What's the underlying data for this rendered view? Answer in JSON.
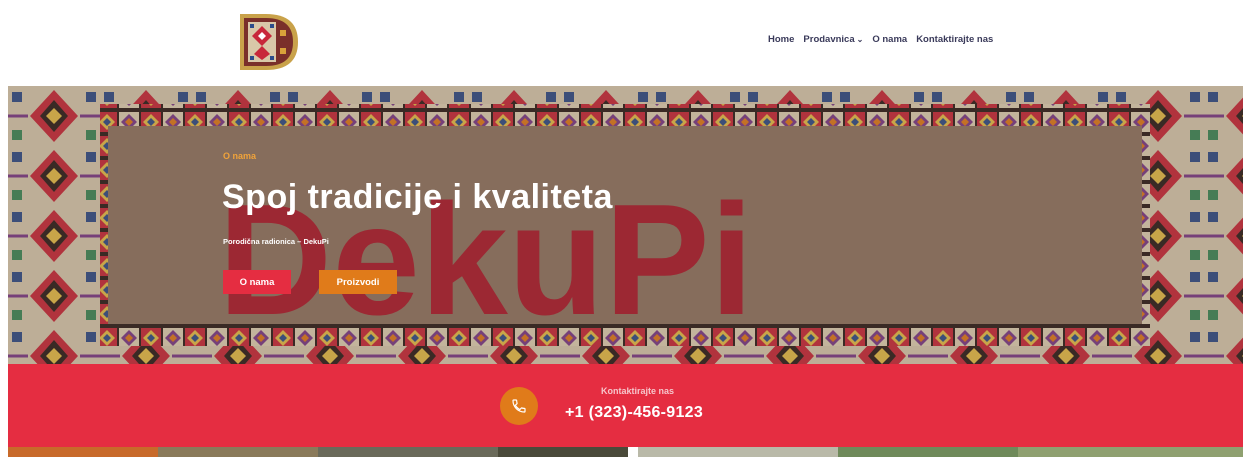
{
  "brand": {
    "logo_icon": "dekupi-d-logo-icon"
  },
  "nav": {
    "items": [
      {
        "label": "Home"
      },
      {
        "label": "Prodavnica",
        "has_dropdown": true,
        "chevron": "⌄"
      },
      {
        "label": "O nama"
      },
      {
        "label": "Kontaktirajte nas"
      }
    ]
  },
  "hero": {
    "tag": "O nama",
    "title": "Spoj tradicije i kvaliteta",
    "subtitle": "Porodična radionica – DekuPi",
    "watermark": "DekuPi",
    "buttons": {
      "primary": "O nama",
      "secondary": "Proizvodi"
    }
  },
  "contact": {
    "label": "Kontaktirajte nas",
    "phone": "+1 (323)-456-9123",
    "icon": "phone-icon"
  },
  "colors": {
    "accent_red": "#e52d41",
    "accent_orange": "#e07b1a",
    "nav_text": "#3a3a5a",
    "tag_orange": "#f0a33a"
  }
}
